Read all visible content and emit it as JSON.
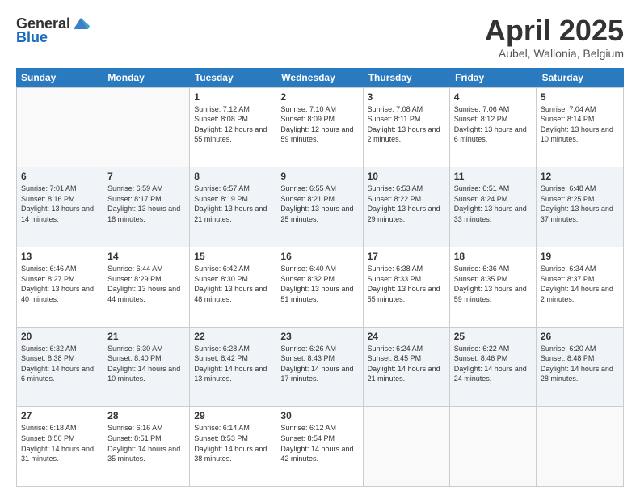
{
  "header": {
    "logo": {
      "general": "General",
      "blue": "Blue"
    },
    "title": "April 2025",
    "subtitle": "Aubel, Wallonia, Belgium"
  },
  "calendar": {
    "weekdays": [
      "Sunday",
      "Monday",
      "Tuesday",
      "Wednesday",
      "Thursday",
      "Friday",
      "Saturday"
    ],
    "weeks": [
      [
        {
          "day": "",
          "sunrise": "",
          "sunset": "",
          "daylight": "",
          "empty": true
        },
        {
          "day": "",
          "sunrise": "",
          "sunset": "",
          "daylight": "",
          "empty": true
        },
        {
          "day": "1",
          "sunrise": "Sunrise: 7:12 AM",
          "sunset": "Sunset: 8:08 PM",
          "daylight": "Daylight: 12 hours and 55 minutes."
        },
        {
          "day": "2",
          "sunrise": "Sunrise: 7:10 AM",
          "sunset": "Sunset: 8:09 PM",
          "daylight": "Daylight: 12 hours and 59 minutes."
        },
        {
          "day": "3",
          "sunrise": "Sunrise: 7:08 AM",
          "sunset": "Sunset: 8:11 PM",
          "daylight": "Daylight: 13 hours and 2 minutes."
        },
        {
          "day": "4",
          "sunrise": "Sunrise: 7:06 AM",
          "sunset": "Sunset: 8:12 PM",
          "daylight": "Daylight: 13 hours and 6 minutes."
        },
        {
          "day": "5",
          "sunrise": "Sunrise: 7:04 AM",
          "sunset": "Sunset: 8:14 PM",
          "daylight": "Daylight: 13 hours and 10 minutes."
        }
      ],
      [
        {
          "day": "6",
          "sunrise": "Sunrise: 7:01 AM",
          "sunset": "Sunset: 8:16 PM",
          "daylight": "Daylight: 13 hours and 14 minutes."
        },
        {
          "day": "7",
          "sunrise": "Sunrise: 6:59 AM",
          "sunset": "Sunset: 8:17 PM",
          "daylight": "Daylight: 13 hours and 18 minutes."
        },
        {
          "day": "8",
          "sunrise": "Sunrise: 6:57 AM",
          "sunset": "Sunset: 8:19 PM",
          "daylight": "Daylight: 13 hours and 21 minutes."
        },
        {
          "day": "9",
          "sunrise": "Sunrise: 6:55 AM",
          "sunset": "Sunset: 8:21 PM",
          "daylight": "Daylight: 13 hours and 25 minutes."
        },
        {
          "day": "10",
          "sunrise": "Sunrise: 6:53 AM",
          "sunset": "Sunset: 8:22 PM",
          "daylight": "Daylight: 13 hours and 29 minutes."
        },
        {
          "day": "11",
          "sunrise": "Sunrise: 6:51 AM",
          "sunset": "Sunset: 8:24 PM",
          "daylight": "Daylight: 13 hours and 33 minutes."
        },
        {
          "day": "12",
          "sunrise": "Sunrise: 6:48 AM",
          "sunset": "Sunset: 8:25 PM",
          "daylight": "Daylight: 13 hours and 37 minutes."
        }
      ],
      [
        {
          "day": "13",
          "sunrise": "Sunrise: 6:46 AM",
          "sunset": "Sunset: 8:27 PM",
          "daylight": "Daylight: 13 hours and 40 minutes."
        },
        {
          "day": "14",
          "sunrise": "Sunrise: 6:44 AM",
          "sunset": "Sunset: 8:29 PM",
          "daylight": "Daylight: 13 hours and 44 minutes."
        },
        {
          "day": "15",
          "sunrise": "Sunrise: 6:42 AM",
          "sunset": "Sunset: 8:30 PM",
          "daylight": "Daylight: 13 hours and 48 minutes."
        },
        {
          "day": "16",
          "sunrise": "Sunrise: 6:40 AM",
          "sunset": "Sunset: 8:32 PM",
          "daylight": "Daylight: 13 hours and 51 minutes."
        },
        {
          "day": "17",
          "sunrise": "Sunrise: 6:38 AM",
          "sunset": "Sunset: 8:33 PM",
          "daylight": "Daylight: 13 hours and 55 minutes."
        },
        {
          "day": "18",
          "sunrise": "Sunrise: 6:36 AM",
          "sunset": "Sunset: 8:35 PM",
          "daylight": "Daylight: 13 hours and 59 minutes."
        },
        {
          "day": "19",
          "sunrise": "Sunrise: 6:34 AM",
          "sunset": "Sunset: 8:37 PM",
          "daylight": "Daylight: 14 hours and 2 minutes."
        }
      ],
      [
        {
          "day": "20",
          "sunrise": "Sunrise: 6:32 AM",
          "sunset": "Sunset: 8:38 PM",
          "daylight": "Daylight: 14 hours and 6 minutes."
        },
        {
          "day": "21",
          "sunrise": "Sunrise: 6:30 AM",
          "sunset": "Sunset: 8:40 PM",
          "daylight": "Daylight: 14 hours and 10 minutes."
        },
        {
          "day": "22",
          "sunrise": "Sunrise: 6:28 AM",
          "sunset": "Sunset: 8:42 PM",
          "daylight": "Daylight: 14 hours and 13 minutes."
        },
        {
          "day": "23",
          "sunrise": "Sunrise: 6:26 AM",
          "sunset": "Sunset: 8:43 PM",
          "daylight": "Daylight: 14 hours and 17 minutes."
        },
        {
          "day": "24",
          "sunrise": "Sunrise: 6:24 AM",
          "sunset": "Sunset: 8:45 PM",
          "daylight": "Daylight: 14 hours and 21 minutes."
        },
        {
          "day": "25",
          "sunrise": "Sunrise: 6:22 AM",
          "sunset": "Sunset: 8:46 PM",
          "daylight": "Daylight: 14 hours and 24 minutes."
        },
        {
          "day": "26",
          "sunrise": "Sunrise: 6:20 AM",
          "sunset": "Sunset: 8:48 PM",
          "daylight": "Daylight: 14 hours and 28 minutes."
        }
      ],
      [
        {
          "day": "27",
          "sunrise": "Sunrise: 6:18 AM",
          "sunset": "Sunset: 8:50 PM",
          "daylight": "Daylight: 14 hours and 31 minutes."
        },
        {
          "day": "28",
          "sunrise": "Sunrise: 6:16 AM",
          "sunset": "Sunset: 8:51 PM",
          "daylight": "Daylight: 14 hours and 35 minutes."
        },
        {
          "day": "29",
          "sunrise": "Sunrise: 6:14 AM",
          "sunset": "Sunset: 8:53 PM",
          "daylight": "Daylight: 14 hours and 38 minutes."
        },
        {
          "day": "30",
          "sunrise": "Sunrise: 6:12 AM",
          "sunset": "Sunset: 8:54 PM",
          "daylight": "Daylight: 14 hours and 42 minutes."
        },
        {
          "day": "",
          "sunrise": "",
          "sunset": "",
          "daylight": "",
          "empty": true
        },
        {
          "day": "",
          "sunrise": "",
          "sunset": "",
          "daylight": "",
          "empty": true
        },
        {
          "day": "",
          "sunrise": "",
          "sunset": "",
          "daylight": "",
          "empty": true
        }
      ]
    ]
  }
}
